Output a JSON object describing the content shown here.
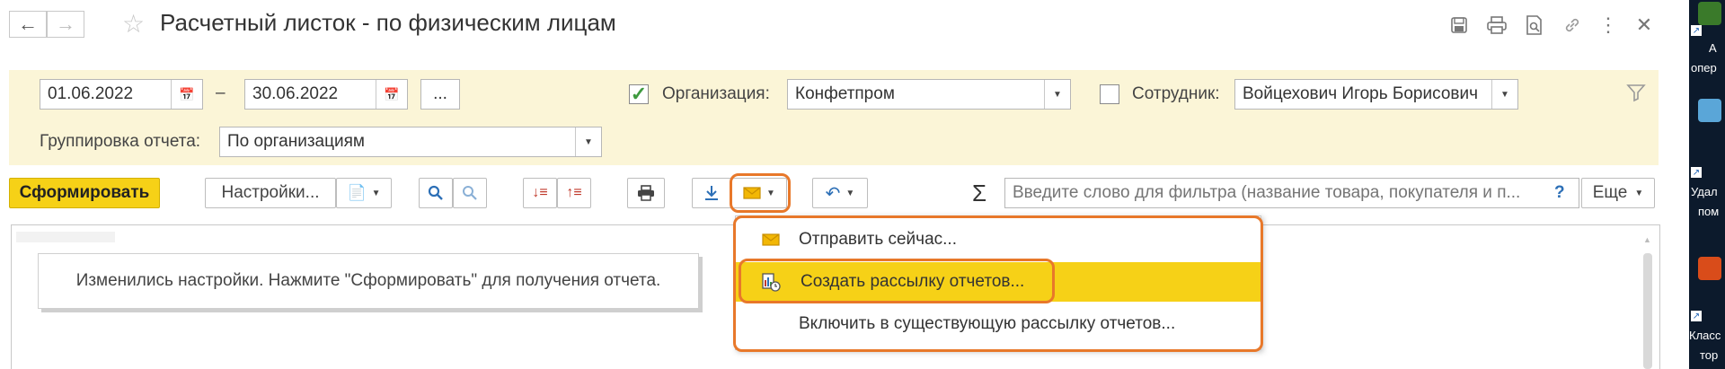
{
  "window": {
    "title": "Расчетный листок - по физическим лицам",
    "back_icon": "arrow-left",
    "forward_icon": "arrow-right"
  },
  "filters": {
    "date_from": "01.06.2022",
    "date_sep": "–",
    "date_to": "30.06.2022",
    "period_button": "...",
    "organization_label": "Организация:",
    "organization_checked": true,
    "organization_value": "Конфетпром",
    "employee_label": "Сотрудник:",
    "employee_checked": false,
    "employee_value": "Войцехович Игорь Борисович",
    "grouping_label": "Группировка отчета:",
    "grouping_value": "По организациям"
  },
  "toolbar": {
    "generate": "Сформировать",
    "settings": "Настройки...",
    "search_placeholder": "Введите слово для фильтра (название товара, покупателя и п...",
    "help": "?",
    "more": "Еще",
    "sum_symbol": "Σ"
  },
  "report": {
    "message": "Изменились настройки. Нажмите \"Сформировать\" для получения отчета."
  },
  "send_menu": {
    "items": [
      {
        "label": "Отправить сейчас...",
        "icon": "envelope-icon"
      },
      {
        "label": "Создать рассылку отчетов...",
        "icon": "report-mailing-icon"
      },
      {
        "label": "Включить в существующую рассылку отчетов...",
        "icon": ""
      }
    ],
    "highlighted_index": 1
  },
  "desktop": {
    "labels": [
      "А",
      "опер",
      "Удал",
      "пом",
      "Класс",
      "тор"
    ]
  },
  "colors": {
    "accent_yellow": "#f6d117",
    "panel_bg": "#fbf5d7",
    "highlight_outline": "#e8782a",
    "link_blue": "#2c6fb6"
  }
}
